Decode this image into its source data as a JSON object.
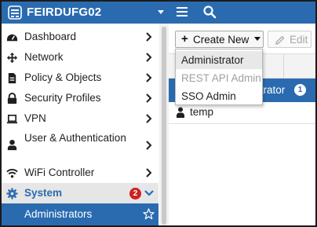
{
  "header": {
    "hostname": "FEIRDUFG02",
    "brand_color": "#2a6bb0"
  },
  "sidebar": {
    "items": [
      {
        "label": "Dashboard",
        "icon": "dashboard-icon"
      },
      {
        "label": "Network",
        "icon": "network-icon"
      },
      {
        "label": "Policy & Objects",
        "icon": "policy-icon"
      },
      {
        "label": "Security Profiles",
        "icon": "lock-icon"
      },
      {
        "label": "VPN",
        "icon": "laptop-icon"
      },
      {
        "label": "User & Authentication",
        "icon": "user-icon"
      },
      {
        "label": "WiFi Controller",
        "icon": "wifi-icon"
      },
      {
        "label": "System",
        "icon": "gear-icon",
        "badge": "2",
        "expanded": true
      },
      {
        "label": "Administrators",
        "icon": "star-icon",
        "active": true
      }
    ]
  },
  "toolbar": {
    "create_label": "Create New",
    "edit_label": "Edit"
  },
  "table": {
    "selected_row_text": "strator",
    "selected_row_badge": "1",
    "row_temp": "temp"
  },
  "create_menu": {
    "items": [
      {
        "label": "Administrator",
        "enabled": true,
        "hover": true
      },
      {
        "label": "REST API Admin",
        "enabled": false
      },
      {
        "label": "SSO Admin",
        "enabled": true
      }
    ]
  },
  "colors": {
    "accent": "#2a6bb0",
    "badge": "#cc2222",
    "selected_row": "#2a6bb0"
  }
}
